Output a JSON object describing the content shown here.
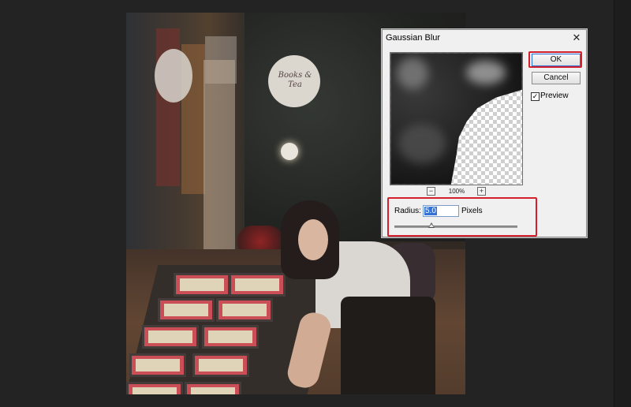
{
  "dialog": {
    "title": "Gaussian Blur",
    "close_icon": "close-icon",
    "ok_label": "OK",
    "cancel_label": "Cancel",
    "preview_label": "Preview",
    "preview_checked": true,
    "zoom_level": "100%",
    "zoom_minus_icon": "zoom-out-icon",
    "zoom_plus_icon": "zoom-in-icon",
    "radius_label": "Radius:",
    "radius_value": "5.0",
    "radius_units": "Pixels",
    "radius_slider_fraction": 0.3
  },
  "photo": {
    "sign_text": "Books & Tea"
  },
  "colors": {
    "highlight": "#d4202c",
    "selection": "#3374d6"
  }
}
